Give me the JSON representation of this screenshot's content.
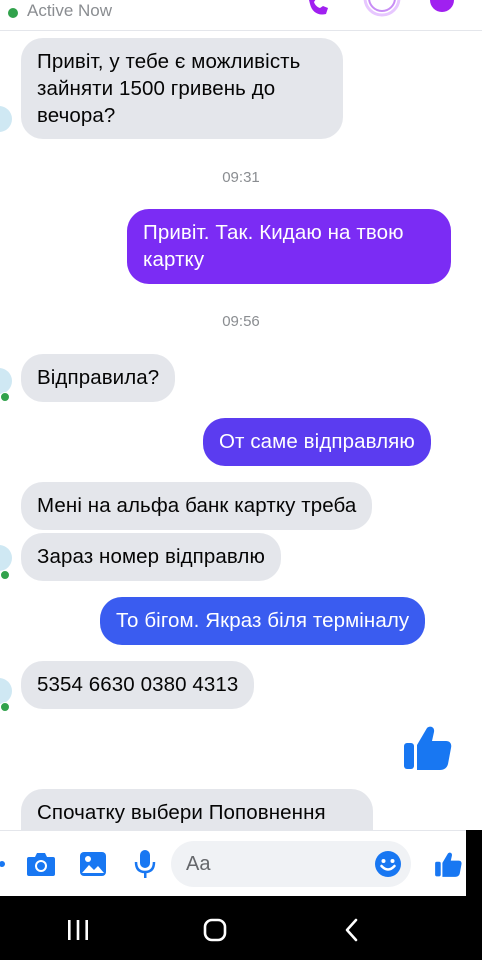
{
  "header": {
    "status": "Active Now",
    "icons": [
      "phone-icon",
      "video-icon",
      "info-icon"
    ]
  },
  "messages": [
    {
      "id": "m1",
      "dir": "in",
      "text": "Привіт, у тебе є можливість зайняти 1500 гривень до вечора?"
    },
    {
      "id": "t1",
      "type": "time",
      "text": "09:31"
    },
    {
      "id": "m2",
      "dir": "out",
      "text": "Привіт. Так. Кидаю на твою картку"
    },
    {
      "id": "t2",
      "type": "time",
      "text": "09:56"
    },
    {
      "id": "m3",
      "dir": "in",
      "text": "Відправила?"
    },
    {
      "id": "m4",
      "dir": "out",
      "text": "От саме відправляю"
    },
    {
      "id": "m5",
      "dir": "in",
      "text": "Мені на альфа банк картку треба"
    },
    {
      "id": "m6",
      "dir": "in",
      "text": "Зараз номер відправлю"
    },
    {
      "id": "m7",
      "dir": "out",
      "text": "То бігом. Якраз біля терміналу"
    },
    {
      "id": "m8",
      "dir": "in",
      "text": "5354 6630 0380 4313"
    },
    {
      "id": "m9",
      "dir": "out",
      "type": "like"
    },
    {
      "id": "m10",
      "dir": "in",
      "text": "Спочатку выбери Поповнення"
    }
  ],
  "composer": {
    "placeholder": "Aa",
    "icons": [
      "menu-icon",
      "camera-icon",
      "gallery-icon",
      "microphone-icon",
      "emoji-icon",
      "like-icon"
    ]
  },
  "colors": {
    "accent": "#0084ff",
    "purple": "#7b2cf4",
    "violet": "#5b3cf0",
    "blue": "#3a5cf0",
    "incoming": "#e4e6eb",
    "online": "#31a24c"
  },
  "navbar": {
    "icons": [
      "recent-apps-icon",
      "home-icon",
      "back-icon"
    ]
  }
}
